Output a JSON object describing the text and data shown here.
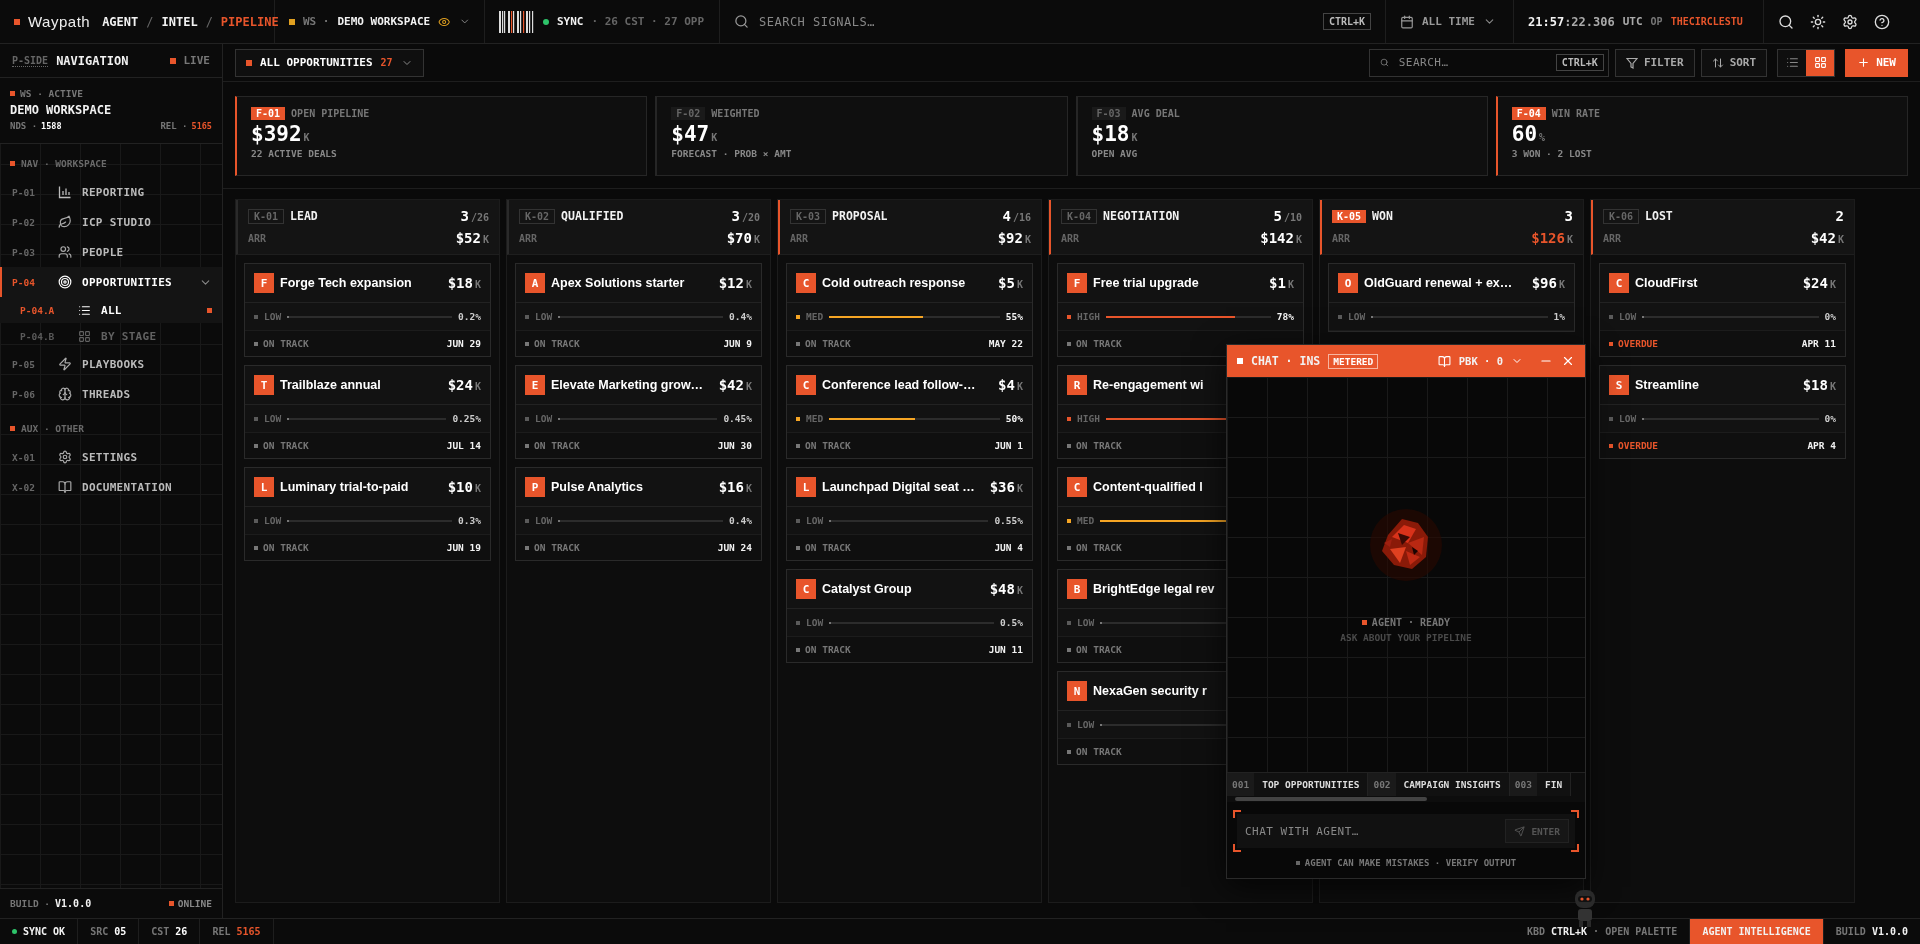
{
  "topbar": {
    "logo": "Waypath",
    "breadcrumb": [
      {
        "label": "AGENT",
        "selected": false
      },
      {
        "label": "INTEL",
        "selected": false
      },
      {
        "label": "PIPELINE",
        "selected": true
      }
    ],
    "separator": "/",
    "workspace": {
      "prefix": "WS ·",
      "name": "DEMO WORKSPACE"
    },
    "sync": {
      "label": "SYNC",
      "stats": "· 26 CST · 27 OPP"
    },
    "search": {
      "placeholder": "SEARCH SIGNALS…",
      "shortcut": "CTRL+K"
    },
    "range": "ALL TIME",
    "clock": {
      "time": "21:57",
      "fraction": ":22.306",
      "zone": "UTC"
    },
    "operator": {
      "label": "OP",
      "name": "THECIRCLESTU"
    }
  },
  "sidebar": {
    "tag": "P-SIDE",
    "title": "NAVIGATION",
    "live": "LIVE",
    "workspace": {
      "label": "WS · ACTIVE",
      "name": "DEMO WORKSPACE",
      "stats": [
        {
          "label": "NDS ·",
          "value": "1588",
          "alert": false
        },
        {
          "label": "REL ·",
          "value": "5165",
          "alert": true
        }
      ]
    },
    "sections": [
      {
        "label": "NAV · WORKSPACE",
        "items": [
          {
            "code": "P-01",
            "label": "REPORTING",
            "selected": false
          },
          {
            "code": "P-02",
            "label": "ICP STUDIO",
            "selected": false
          },
          {
            "code": "P-03",
            "label": "PEOPLE",
            "selected": false
          },
          {
            "code": "P-04",
            "label": "OPPORTUNITIES",
            "selected": true,
            "expanded": true,
            "children": [
              {
                "code": "P-04.A",
                "label": "ALL",
                "selected": true,
                "disabled": false
              },
              {
                "code": "P-04.B",
                "label": "BY STAGE",
                "selected": false,
                "disabled": true
              }
            ]
          },
          {
            "code": "P-05",
            "label": "PLAYBOOKS",
            "selected": false
          },
          {
            "code": "P-06",
            "label": "THREADS",
            "selected": false
          }
        ]
      },
      {
        "label": "AUX · OTHER",
        "items": [
          {
            "code": "X-01",
            "label": "SETTINGS",
            "selected": false
          },
          {
            "code": "X-02",
            "label": "DOCUMENTATION",
            "selected": false
          }
        ]
      }
    ],
    "footer": {
      "build": "BUILD ·",
      "version": "V1.0.0",
      "status": "ONLINE"
    }
  },
  "toolbar": {
    "view": {
      "label": "ALL OPPORTUNITIES",
      "count": "27"
    },
    "search": {
      "placeholder": "SEARCH…",
      "shortcut": "CTRL+K"
    },
    "buttons": [
      "FILTER",
      "SORT"
    ],
    "views": [
      {
        "selected": false
      },
      {
        "selected": true
      }
    ],
    "new": "NEW"
  },
  "kpis": [
    {
      "code": "F-01",
      "label": "OPEN PIPELINE",
      "value": "$392",
      "unit": "K",
      "note": "22 ACTIVE DEALS",
      "highlight": true
    },
    {
      "code": "F-02",
      "label": "WEIGHTED",
      "value": "$47",
      "unit": "K",
      "note": "FORECAST · PROB × AMT",
      "highlight": false
    },
    {
      "code": "F-03",
      "label": "AVG DEAL",
      "value": "$18",
      "unit": "K",
      "note": "OPEN AVG",
      "highlight": false
    },
    {
      "code": "F-04",
      "label": "WIN RATE",
      "value": "60",
      "unit": "%",
      "note": "3 WON · 2 LOST",
      "highlight": true
    }
  ],
  "columns": [
    {
      "code": "K-01",
      "name": "LEAD",
      "count": "3",
      "limit": "/26",
      "arr": "ARR",
      "total": "$52",
      "unit": "K",
      "accent": false,
      "highlight": false,
      "cards": [
        {
          "initial": "F",
          "title": "Forge Tech expansion",
          "amount": "$18",
          "unit": "K",
          "priority": {
            "kind": "low",
            "label": "LOW"
          },
          "level": 0.002,
          "pct": "0.2%",
          "status": {
            "kind": "ok",
            "label": "ON TRACK"
          },
          "date": "JUN 29"
        },
        {
          "initial": "T",
          "title": "Trailblaze annual",
          "amount": "$24",
          "unit": "K",
          "priority": {
            "kind": "low",
            "label": "LOW"
          },
          "level": 0.0025,
          "pct": "0.25%",
          "status": {
            "kind": "ok",
            "label": "ON TRACK"
          },
          "date": "JUL 14"
        },
        {
          "initial": "L",
          "title": "Luminary trial-to-paid",
          "amount": "$10",
          "unit": "K",
          "priority": {
            "kind": "low",
            "label": "LOW"
          },
          "level": 0.003,
          "pct": "0.3%",
          "status": {
            "kind": "ok",
            "label": "ON TRACK"
          },
          "date": "JUN 19"
        }
      ]
    },
    {
      "code": "K-02",
      "name": "QUALIFIED",
      "count": "3",
      "limit": "/20",
      "arr": "ARR",
      "total": "$70",
      "unit": "K",
      "accent": false,
      "highlight": false,
      "cards": [
        {
          "initial": "A",
          "title": "Apex Solutions starter",
          "amount": "$12",
          "unit": "K",
          "priority": {
            "kind": "low",
            "label": "LOW"
          },
          "level": 0.004,
          "pct": "0.4%",
          "status": {
            "kind": "ok",
            "label": "ON TRACK"
          },
          "date": "JUN 9"
        },
        {
          "initial": "E",
          "title": "Elevate Marketing grow…",
          "amount": "$42",
          "unit": "K",
          "priority": {
            "kind": "low",
            "label": "LOW"
          },
          "level": 0.0045,
          "pct": "0.45%",
          "status": {
            "kind": "ok",
            "label": "ON TRACK"
          },
          "date": "JUN 30"
        },
        {
          "initial": "P",
          "title": "Pulse Analytics",
          "amount": "$16",
          "unit": "K",
          "priority": {
            "kind": "low",
            "label": "LOW"
          },
          "level": 0.004,
          "pct": "0.4%",
          "status": {
            "kind": "ok",
            "label": "ON TRACK"
          },
          "date": "JUN 24"
        }
      ]
    },
    {
      "code": "K-03",
      "name": "PROPOSAL",
      "count": "4",
      "limit": "/16",
      "arr": "ARR",
      "total": "$92",
      "unit": "K",
      "accent": true,
      "highlight": false,
      "cards": [
        {
          "initial": "C",
          "title": "Cold outreach response",
          "amount": "$5",
          "unit": "K",
          "priority": {
            "kind": "med",
            "label": "MED"
          },
          "level": 0.55,
          "pct": "55%",
          "status": {
            "kind": "ok",
            "label": "ON TRACK"
          },
          "date": "MAY 22"
        },
        {
          "initial": "C",
          "title": "Conference lead follow-…",
          "amount": "$4",
          "unit": "K",
          "priority": {
            "kind": "med",
            "label": "MED"
          },
          "level": 0.5,
          "pct": "50%",
          "status": {
            "kind": "ok",
            "label": "ON TRACK"
          },
          "date": "JUN 1"
        },
        {
          "initial": "L",
          "title": "Launchpad Digital seat …",
          "amount": "$36",
          "unit": "K",
          "priority": {
            "kind": "low",
            "label": "LOW"
          },
          "level": 0.0055,
          "pct": "0.55%",
          "status": {
            "kind": "ok",
            "label": "ON TRACK"
          },
          "date": "JUN 4"
        },
        {
          "initial": "C",
          "title": "Catalyst Group",
          "amount": "$48",
          "unit": "K",
          "priority": {
            "kind": "low",
            "label": "LOW"
          },
          "level": 0.005,
          "pct": "0.5%",
          "status": {
            "kind": "ok",
            "label": "ON TRACK"
          },
          "date": "JUN 11"
        }
      ]
    },
    {
      "code": "K-04",
      "name": "NEGOTIATION",
      "count": "5",
      "limit": "/10",
      "arr": "ARR",
      "total": "$142",
      "unit": "K",
      "accent": true,
      "highlight": false,
      "cards": [
        {
          "initial": "F",
          "title": "Free trial upgrade",
          "amount": "$1",
          "unit": "K",
          "priority": {
            "kind": "high",
            "label": "HIGH"
          },
          "level": 0.78,
          "pct": "78%",
          "status": {
            "kind": "ok",
            "label": "ON TRACK"
          }
        },
        {
          "initial": "R",
          "title": "Re-engagement wi",
          "priority": {
            "kind": "high",
            "label": "HIGH"
          },
          "level": 0.8,
          "status": {
            "kind": "ok",
            "label": "ON TRACK"
          }
        },
        {
          "initial": "C",
          "title": "Content-qualified l",
          "priority": {
            "kind": "med",
            "label": "MED"
          },
          "level": 0.65,
          "status": {
            "kind": "ok",
            "label": "ON TRACK"
          }
        },
        {
          "initial": "B",
          "title": "BrightEdge legal rev",
          "priority": {
            "kind": "low",
            "label": "LOW"
          },
          "level": 0.005,
          "status": {
            "kind": "ok",
            "label": "ON TRACK"
          }
        },
        {
          "initial": "N",
          "title": "NexaGen security r",
          "priority": {
            "kind": "low",
            "label": "LOW"
          },
          "level": 0.005,
          "status": {
            "kind": "ok",
            "label": "ON TRACK"
          }
        }
      ]
    },
    {
      "code": "K-05",
      "name": "WON",
      "count": "3",
      "arr": "ARR",
      "total": "$126",
      "unit": "K",
      "accent": true,
      "highlight": true,
      "cards": [
        {
          "initial": "O",
          "title": "OldGuard renewal + ex…",
          "amount": "$96",
          "unit": "K",
          "priority": {
            "kind": "low",
            "label": "LOW"
          },
          "level": 0.01,
          "pct": "1%"
        }
      ]
    },
    {
      "code": "K-06",
      "name": "LOST",
      "count": "2",
      "arr": "ARR",
      "total": "$42",
      "unit": "K",
      "accent": true,
      "highlight": false,
      "cards": [
        {
          "initial": "C",
          "title": "CloudFirst",
          "amount": "$24",
          "unit": "K",
          "priority": {
            "kind": "low",
            "label": "LOW"
          },
          "level": 0,
          "pct": "0%",
          "status": {
            "kind": "overdue",
            "label": "OVERDUE"
          },
          "date": "APR 11"
        },
        {
          "initial": "S",
          "title": "Streamline",
          "amount": "$18",
          "unit": "K",
          "priority": {
            "kind": "low",
            "label": "LOW"
          },
          "level": 0,
          "pct": "0%",
          "status": {
            "kind": "overdue",
            "label": "OVERDUE"
          },
          "date": "APR 4"
        }
      ]
    }
  ],
  "chat": {
    "title": "CHAT · INS",
    "badge": "METERED",
    "playbook": "PBK · 0",
    "status": "AGENT · READY",
    "hint": "ASK ABOUT YOUR PIPELINE",
    "suggestions": [
      {
        "code": "001",
        "label": "TOP OPPORTUNITIES"
      },
      {
        "code": "002",
        "label": "CAMPAIGN INSIGHTS"
      },
      {
        "code": "003",
        "label": "FIN"
      }
    ],
    "input": {
      "placeholder": "CHAT WITH AGENT…"
    },
    "send": "ENTER",
    "disclaimer": "AGENT CAN MAKE MISTAKES · VERIFY OUTPUT"
  },
  "status_bar": {
    "sync": "SYNC OK",
    "stats": [
      {
        "label": "SRC",
        "value": "05",
        "alert": false
      },
      {
        "label": "CST",
        "value": "26",
        "alert": false
      },
      {
        "label": "REL",
        "value": "5165",
        "alert": true
      }
    ],
    "kbd": {
      "label": "KBD",
      "key": "CTRL+K",
      "action": "· OPEN PALETTE"
    },
    "mode": "AGENT INTELLIGENCE",
    "build": {
      "label": "BUILD",
      "value": "V1.0.0"
    }
  }
}
